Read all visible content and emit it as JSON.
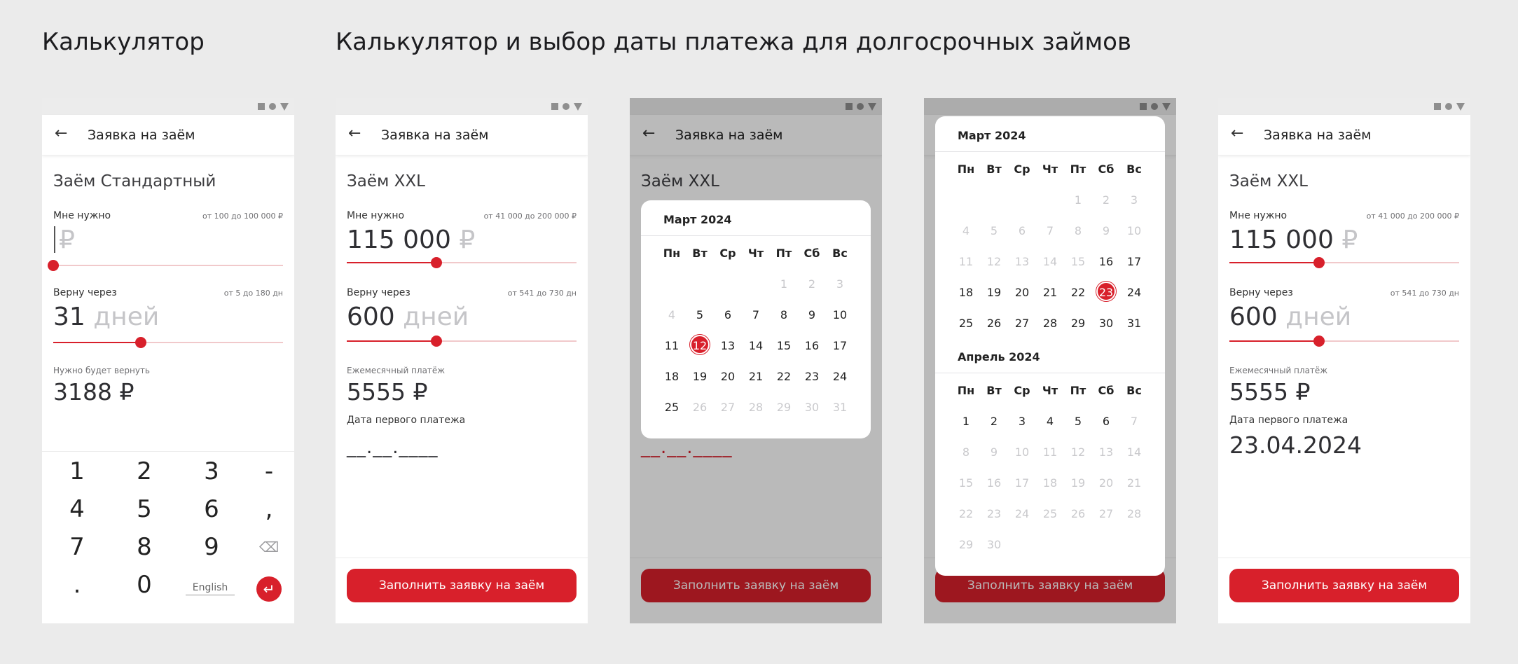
{
  "titles": {
    "calculator": "Калькулятор",
    "long_term": "Калькулятор и выбор даты платежа для долгосрочных займов"
  },
  "appbar": {
    "back": "←",
    "title": "Заявка на заём"
  },
  "screen1": {
    "product": "Заём Стандартный",
    "need_label": "Мне нужно",
    "need_range": "от 100 до 100 000 ₽",
    "need_value": "",
    "need_unit": "₽",
    "need_level": 0,
    "term_label": "Верну через",
    "term_range": "от 5 до 180 дн",
    "term_value": "31",
    "term_unit": "дней",
    "term_level": 0.38,
    "return_label": "Нужно будет вернуть",
    "return_value": "3188 ₽",
    "keys": [
      "1",
      "2",
      "3",
      "-",
      "4",
      "5",
      "6",
      ",",
      "7",
      "8",
      "9",
      "⌫",
      ".",
      "0",
      "English",
      "↵"
    ]
  },
  "screen_xxl": {
    "product": "Заём XXL",
    "need_label": "Мне нужно",
    "need_range": "от 41 000 до 200 000 ₽",
    "need_value": "115 000",
    "need_unit": "₽",
    "need_level": 0.39,
    "term_label": "Верну через",
    "term_range": "от 541 до 730 дн",
    "term_value": "600",
    "term_unit": "дней",
    "term_level": 0.39,
    "monthly_label": "Ежемесячный платёж",
    "monthly_value": "5555 ₽",
    "first_date_label": "Дата первого платежа",
    "first_date_placeholder": "__.__.____",
    "first_date_value": "23.04.2024",
    "cta": "Заполнить заявку на заём"
  },
  "weekdays": [
    "Пн",
    "Вт",
    "Ср",
    "Чт",
    "Пт",
    "Сб",
    "Вс"
  ],
  "calendar_march": {
    "title": "Март 2024",
    "days": [
      "",
      "",
      "",
      "",
      "1",
      "2",
      "3",
      "4",
      "5",
      "6",
      "7",
      "8",
      "9",
      "10",
      "11",
      "12",
      "13",
      "14",
      "15",
      "16",
      "17",
      "18",
      "19",
      "20",
      "21",
      "22",
      "23",
      "24",
      "25",
      "26",
      "27",
      "28",
      "29",
      "30",
      "31"
    ],
    "selected": "12",
    "enabled_from": "5",
    "enabled_to": "25"
  },
  "calendar_march_b": {
    "title": "Март 2024",
    "selected": "23",
    "enabled_from": "16",
    "enabled_to": "31"
  },
  "calendar_april": {
    "title": "Апрель 2024",
    "days": [
      "1",
      "2",
      "3",
      "4",
      "5",
      "6",
      "7",
      "8",
      "9",
      "10",
      "11",
      "12",
      "13",
      "14",
      "15",
      "16",
      "17",
      "18",
      "19",
      "20",
      "21",
      "22",
      "23",
      "24",
      "25",
      "26",
      "27",
      "28",
      "29",
      "30"
    ],
    "enabled_from": "1",
    "enabled_to": "6"
  },
  "colors": {
    "accent": "#d8202b",
    "track": "#f1c9cb",
    "muted": "#c9c9cc"
  }
}
